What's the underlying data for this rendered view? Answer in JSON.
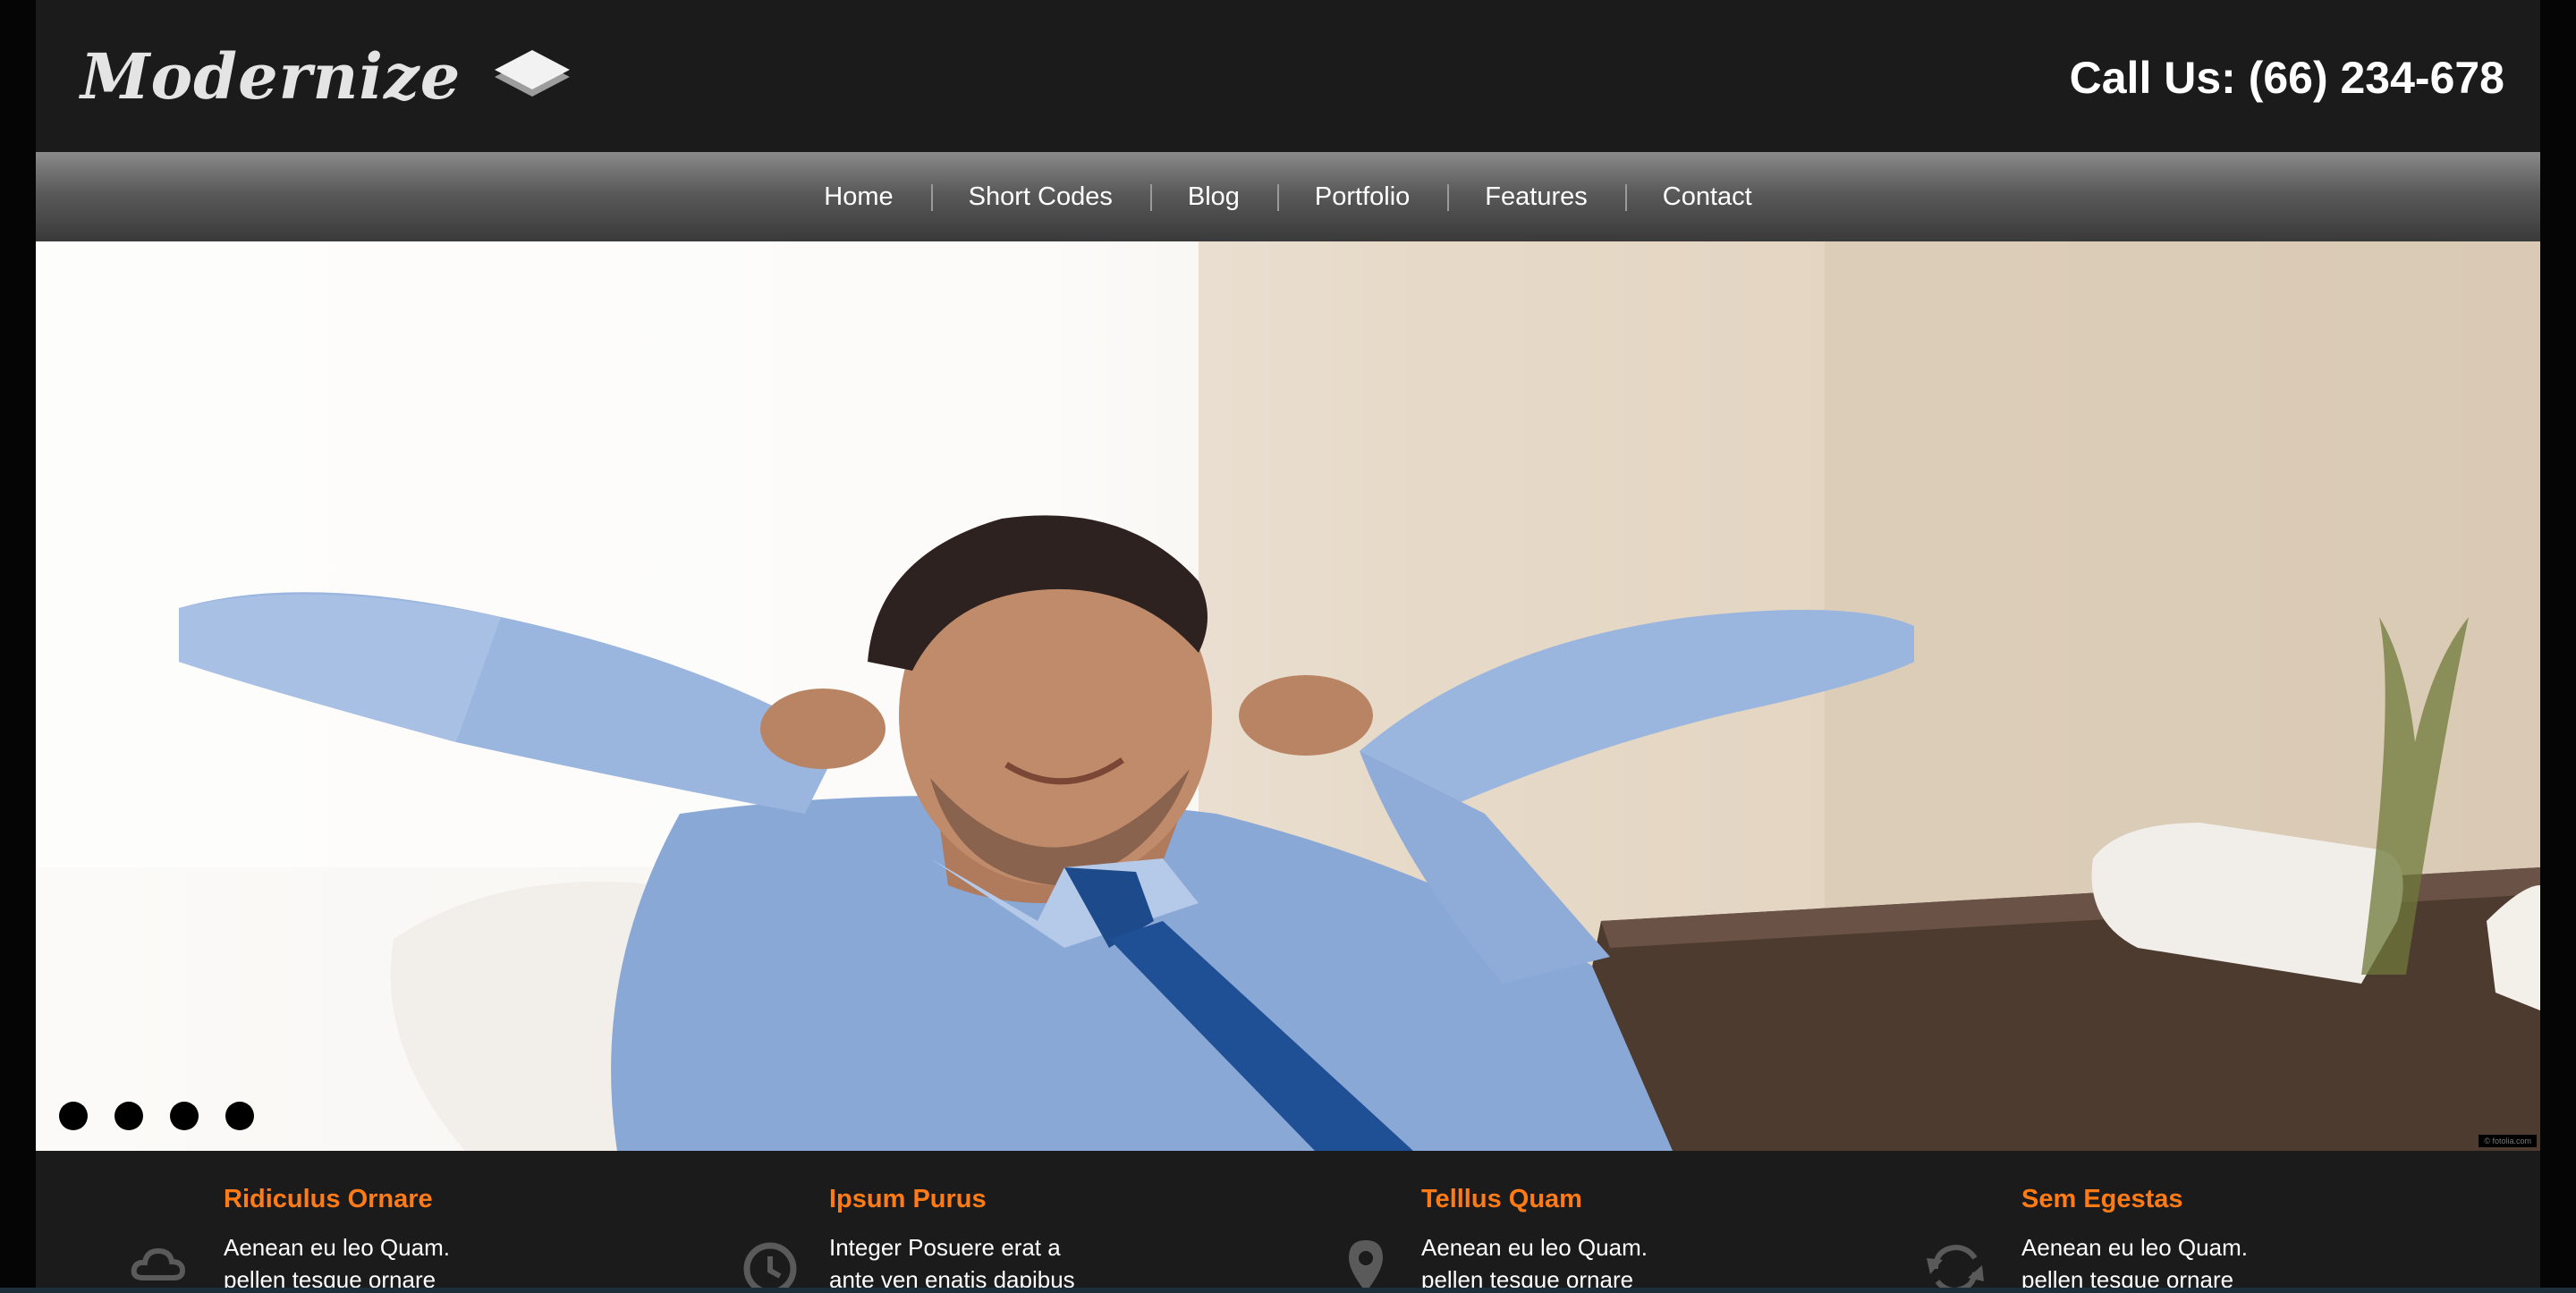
{
  "header": {
    "logo_text": "Modernize",
    "phone": "Call Us: (66) 234-678"
  },
  "nav": {
    "items": [
      "Home",
      "Short Codes",
      "Blog",
      "Portfolio",
      "Features",
      "Contact"
    ]
  },
  "slider": {
    "dot_count": 4,
    "credit": "© fotolia.com"
  },
  "features": [
    {
      "title": "Ridiculus Ornare",
      "line1": "Aenean eu leo Quam.",
      "line2": "pellen tesque ornare",
      "icon": "cloud-icon"
    },
    {
      "title": "Ipsum Purus",
      "line1": "Integer Posuere erat a",
      "line2": "ante ven enatis dapibus",
      "icon": "clock-icon"
    },
    {
      "title": "Telllus Quam",
      "line1": "Aenean eu leo Quam.",
      "line2": "pellen tesque ornare",
      "icon": "map-pin-icon"
    },
    {
      "title": "Sem Egestas",
      "line1": "Aenean eu leo Quam.",
      "line2": "pellen tesque ornare",
      "icon": "refresh-icon"
    }
  ],
  "colors": {
    "accent": "#ff7b16",
    "background": "#1b1b1b",
    "nav_top": "#8a8a8a",
    "nav_bottom": "#3a3a3a"
  }
}
